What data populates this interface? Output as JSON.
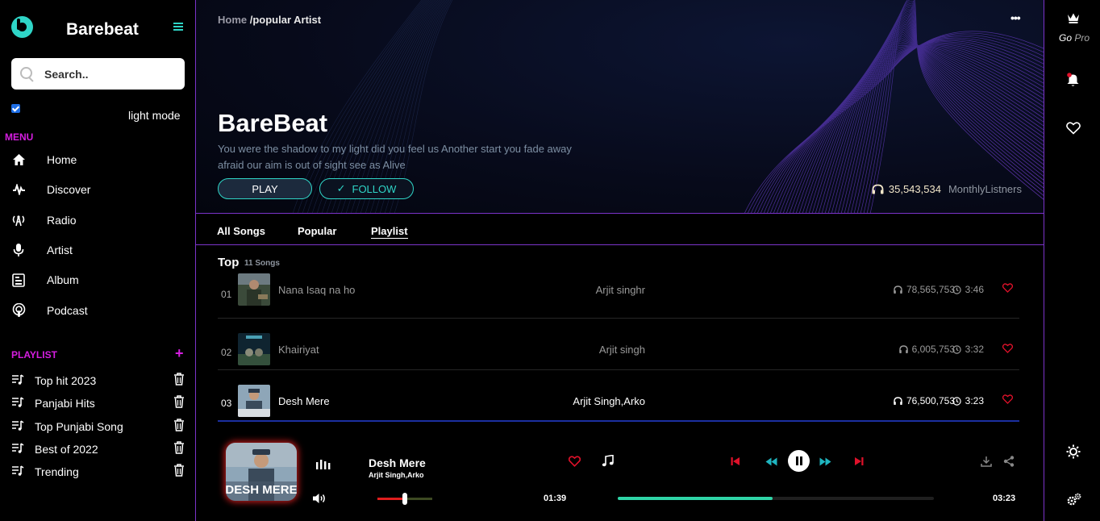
{
  "brand": {
    "name": "Barebeat"
  },
  "search": {
    "placeholder": "Search.."
  },
  "mode": {
    "label": "light mode",
    "checked": true
  },
  "menu": {
    "title": "MENU",
    "items": [
      {
        "label": "Home",
        "icon": "home-icon"
      },
      {
        "label": "Discover",
        "icon": "pulse-icon"
      },
      {
        "label": "Radio",
        "icon": "radio-icon"
      },
      {
        "label": "Artist",
        "icon": "mic-icon"
      },
      {
        "label": "Album",
        "icon": "album-icon"
      },
      {
        "label": "Podcast",
        "icon": "podcast-icon"
      }
    ]
  },
  "playlist": {
    "title": "PLAYLIST",
    "add": "+",
    "items": [
      {
        "label": "Top hit 2023"
      },
      {
        "label": "Panjabi Hits"
      },
      {
        "label": "Top Punjabi Song"
      },
      {
        "label": "Best of 2022"
      },
      {
        "label": "Trending"
      }
    ]
  },
  "breadcrumb": {
    "home": "Home",
    "current": "/popular Artist"
  },
  "hero": {
    "title": "BareBeat",
    "description": "You were the shadow to my light did you feel us Another start you fade away afraid our aim is out of sight see as Alive",
    "play_label": "PLAY",
    "follow_label": "FOLLOW",
    "listeners_count": "35,543,534",
    "listeners_label": "MonthlyListners"
  },
  "tabs": [
    {
      "label": "All Songs",
      "active": false
    },
    {
      "label": "Popular",
      "active": false
    },
    {
      "label": "Playlist",
      "active": true
    }
  ],
  "top": {
    "title": "Top",
    "count": "11 Songs"
  },
  "songs": [
    {
      "num": "01",
      "title": "Nana Isaq na ho",
      "artist": "Arjit singhr",
      "plays": "78,565,753",
      "duration": "3:46",
      "active": false
    },
    {
      "num": "02",
      "title": "Khairiyat",
      "artist": "Arjit singh",
      "plays": "6,005,753",
      "duration": "3:32",
      "active": false
    },
    {
      "num": "03",
      "title": "Desh Mere",
      "artist": "Arjit Singh,Arko",
      "plays": "76,500,753",
      "duration": "3:23",
      "active": true
    }
  ],
  "player": {
    "cover_text": "DESH MERE",
    "song": "Desh Mere",
    "artist": "Arjit Singh,Arko",
    "current_time": "01:39",
    "total_time": "03:23",
    "progress": 0.49,
    "volume": 0.5
  },
  "rail": {
    "go": "Go",
    "pro": "Pro"
  },
  "colors": {
    "accent": "#2fd5c7",
    "magenta": "#d51ee0",
    "heart": "#e0112a",
    "border": "#7b33c9",
    "progress": "#2fd5a7"
  }
}
